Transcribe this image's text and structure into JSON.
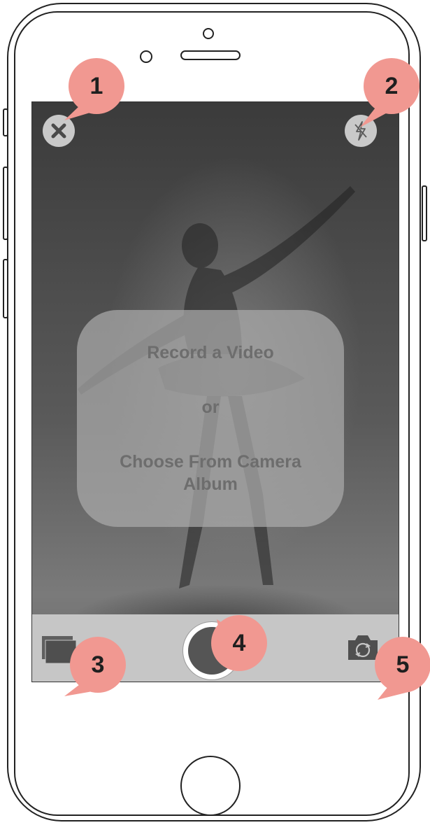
{
  "screen": {
    "message": {
      "title": "Record a Video",
      "separator": "or",
      "subtitle": "Choose From Camera Album"
    },
    "controls": {
      "close_icon": "close-icon",
      "flash_icon": "flash-off-icon",
      "album_icon": "camera-album-icon",
      "shutter_icon": "record-button",
      "flip_icon": "camera-flip-icon"
    }
  },
  "annotations": [
    {
      "label": "1"
    },
    {
      "label": "2"
    },
    {
      "label": "3"
    },
    {
      "label": "4"
    },
    {
      "label": "5"
    }
  ],
  "colors": {
    "marker": "#f19891",
    "bottom_bar": "#c6c6c6",
    "shutter": "#555555"
  }
}
